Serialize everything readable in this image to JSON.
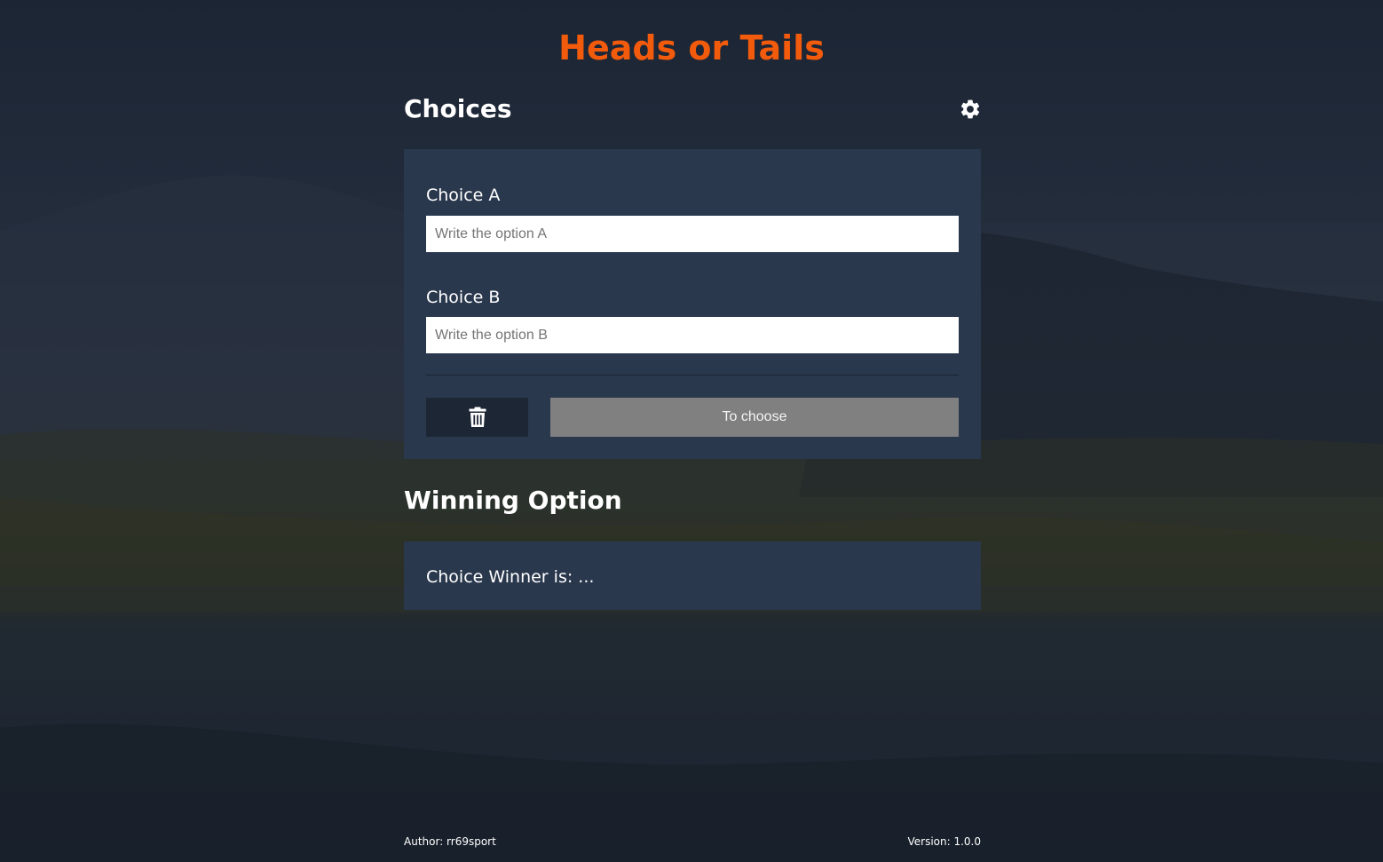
{
  "app": {
    "title": "Heads or Tails",
    "accent_color": "#f25a0c"
  },
  "choices": {
    "heading": "Choices",
    "settings_icon": "gear-icon",
    "choice_a": {
      "label": "Choice A",
      "value": "",
      "placeholder": "Write the option A"
    },
    "choice_b": {
      "label": "Choice B",
      "value": "",
      "placeholder": "Write the option B"
    },
    "delete_icon": "trash-icon",
    "choose_label": "To choose"
  },
  "winner": {
    "heading": "Winning Option",
    "text": "Choice Winner is: ..."
  },
  "footer": {
    "author": "Author: rr69sport",
    "version": "Version: 1.0.0"
  }
}
